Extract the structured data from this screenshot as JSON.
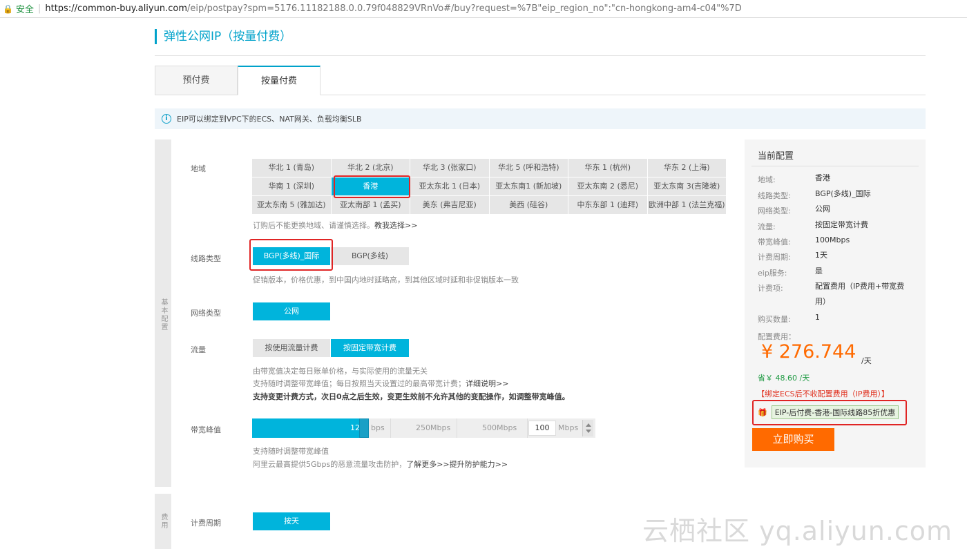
{
  "browser": {
    "secure_label": "安全",
    "url_host": "https://common-buy.aliyun.com",
    "url_path": "/eip/postpay?spm=5176.11182188.0.0.79f048829VRnVo#/buy?request=%7B\"eip_region_no\":\"cn-hongkong-am4-c04\"%7D"
  },
  "page": {
    "title": "弹性公网IP（按量付费）"
  },
  "tabs": [
    {
      "label": "预付费",
      "active": false
    },
    {
      "label": "按量付费",
      "active": true
    }
  ],
  "notice": {
    "icon": "info-icon",
    "text": "EIP可以绑定到VPC下的ECS、NAT网关、负载均衡SLB"
  },
  "config": {
    "side_label": "基本配置",
    "region": {
      "label": "地域",
      "options": [
        "华北 1 (青岛)",
        "华北 2 (北京)",
        "华北 3 (张家口)",
        "华北 5 (呼和浩特)",
        "华东 1 (杭州)",
        "华东 2 (上海)",
        "华南 1 (深圳)",
        "香港",
        "亚太东北 1 (日本)",
        "亚太东南1 (新加坡)",
        "亚太东南 2 (悉尼)",
        "亚太东南 3(吉隆坡)",
        "亚太东南 5 (雅加达)",
        "亚太南部 1 (孟买)",
        "美东 (弗吉尼亚)",
        "美西 (硅谷)",
        "中东东部 1 (迪拜)",
        "欧洲中部 1 (法兰克福)"
      ],
      "selected": "香港",
      "hint_text": "订购后不能更换地域、请谨慎选择。",
      "hint_link": "教我选择>>"
    },
    "line": {
      "label": "线路类型",
      "options": [
        "BGP(多线)_国际",
        "BGP(多线)"
      ],
      "selected": "BGP(多线)_国际",
      "hint": "促销版本，价格优惠，到中国内地时延略高，到其他区域时延和非促销版本一致"
    },
    "network": {
      "label": "网络类型",
      "options": [
        "公网"
      ],
      "selected": "公网"
    },
    "traffic": {
      "label": "流量",
      "options": [
        "按使用流量计费",
        "按固定带宽计费"
      ],
      "selected": "按固定带宽计费",
      "hint1": "由带宽值决定每日账单价格，与实际使用的流量无关",
      "hint2_text": "支持随时调整带宽峰值；每日按照当天设置过的最高带宽计费；",
      "hint2_link": "详细说明>>",
      "hint3": "支持变更计费方式，次日0点之后生效，变更生效前不允许其他的变配操作，如调整带宽峰值。"
    },
    "bandwidth": {
      "label": "带宽峰值",
      "slider_value_text": "12",
      "slider_unit_tail": "bps",
      "fill_fraction": 0.325,
      "marks": [
        "250Mbps",
        "500Mbps"
      ],
      "input_value": "100",
      "unit": "Mbps",
      "hint1": "支持随时调整带宽峰值",
      "hint2_text": "阿里云最高提供5Gbps的恶意流量攻击防护，",
      "hint2_link": "了解更多>>提升防护能力>>"
    }
  },
  "billing": {
    "side_label": "费用",
    "period": {
      "label": "计费周期",
      "options": [
        "按天"
      ],
      "selected": "按天"
    }
  },
  "summary": {
    "title": "当前配置",
    "rows": [
      {
        "key": "地域:",
        "value": "香港"
      },
      {
        "key": "线路类型:",
        "value": "BGP(多线)_国际"
      },
      {
        "key": "网络类型:",
        "value": "公网"
      },
      {
        "key": "流量:",
        "value": "按固定带宽计费"
      },
      {
        "key": "带宽峰值:",
        "value": "100Mbps"
      },
      {
        "key": "计费周期:",
        "value": "1天"
      },
      {
        "key": "eip服务:",
        "value": "是"
      },
      {
        "key": "计费项:",
        "value": "配置费用（IP费用+带宽费用）"
      },
      {
        "key": "购买数量:",
        "value": "1"
      }
    ],
    "fee_label": "配置费用：",
    "price": "¥ 276.744",
    "price_unit": "/天",
    "save": "省￥ 48.60 /天",
    "promo_note": "【绑定ECS后不收配置费用（IP费用）】",
    "coupon": "EIP-后付费-香港-国际线路85折优惠",
    "buy_button": "立即购买"
  },
  "watermark": "云栖社区 yq.aliyun.com",
  "colors": {
    "accent": "#00b4dc",
    "price": "#ff6a00",
    "highlight_box": "#e02424"
  }
}
